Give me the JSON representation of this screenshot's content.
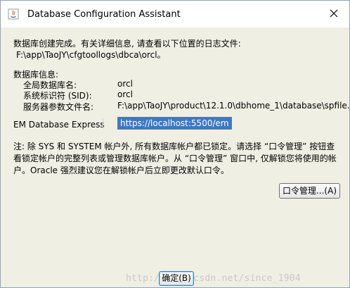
{
  "window": {
    "title": "Database Configuration Assistant"
  },
  "message": {
    "line1": "数据库创建完成。有关详细信息, 请查看以下位置的日志文件:",
    "log_path": "F:\\app\\TaoJY\\cfgtoollogs\\dbca\\orcl。"
  },
  "db_info": {
    "header": "数据库信息:",
    "rows": [
      {
        "label": "全局数据库名:",
        "value": "orcl"
      },
      {
        "label": "系统标识符 (SID):",
        "value": "orcl"
      },
      {
        "label": "服务器参数文件名:",
        "value": "F:\\app\\TaoJY\\product\\12.1.0\\dbhome_1\\database\\spfile..."
      }
    ]
  },
  "em": {
    "label": "EM Database Express",
    "url": "https://localhost:5500/em"
  },
  "note": {
    "line1": "注: 除 SYS 和 SYSTEM 帐户外, 所有数据库帐户都已锁定。请选择 “口令管理” 按钮查",
    "line2": "看锁定帐户的完整列表或管理数据库帐户。从 “口令管理” 窗口中, 仅解锁您将使用的帐",
    "line3": "户。Oracle 强烈建议您在解锁帐户后立即更改默认口令。"
  },
  "buttons": {
    "password_management": "口令管理...(A)",
    "ok": "确定(B)"
  },
  "watermark": "http://blog.csdn.net/since_1904"
}
